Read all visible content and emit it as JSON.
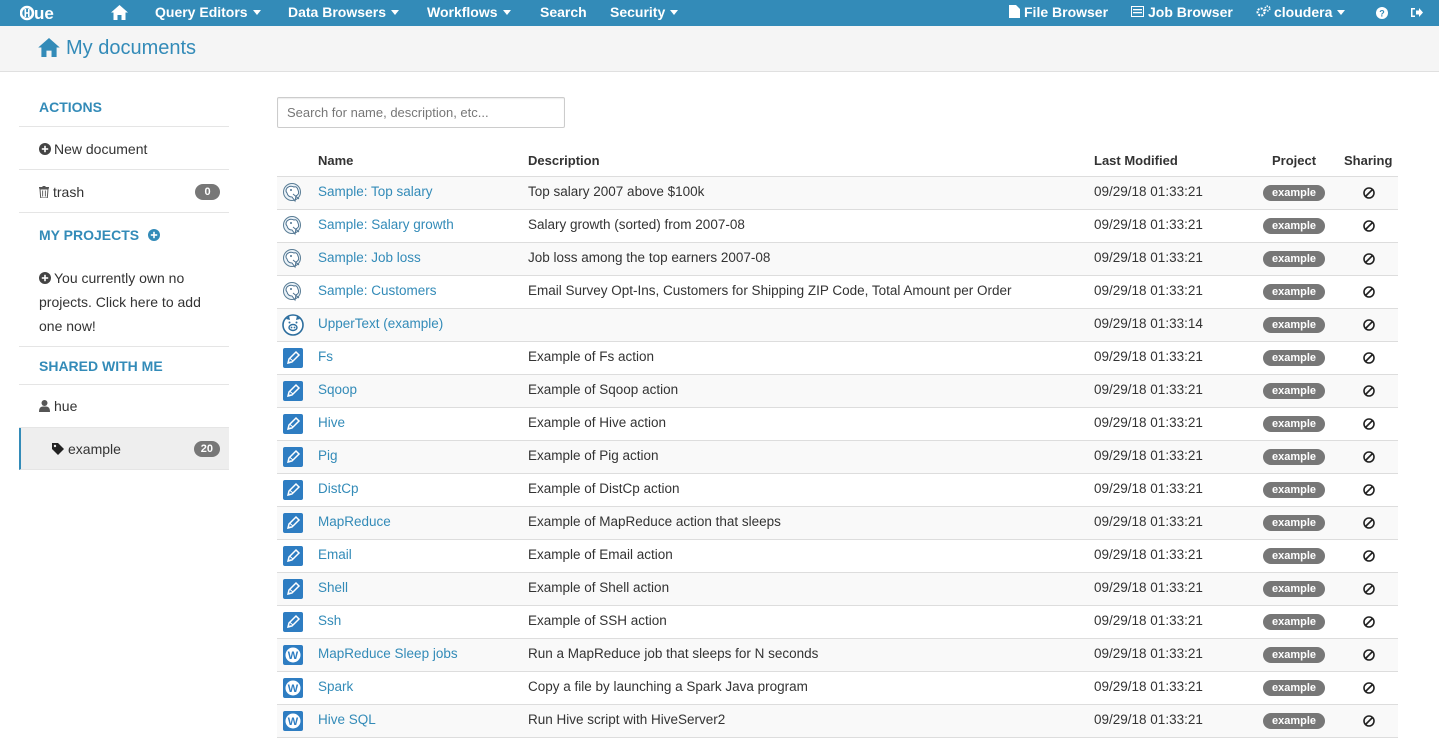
{
  "navbar": {
    "logo_text": "HUE",
    "items": [
      {
        "label": "Query Editors",
        "dropdown": true
      },
      {
        "label": "Data Browsers",
        "dropdown": true
      },
      {
        "label": "Workflows",
        "dropdown": true
      },
      {
        "label": "Search",
        "dropdown": false
      },
      {
        "label": "Security",
        "dropdown": true
      }
    ],
    "right": {
      "file_browser": "File Browser",
      "job_browser": "Job Browser",
      "user": "cloudera"
    },
    "icons": [
      "home-icon",
      "file-icon",
      "job-icon",
      "cogs-icon",
      "help-icon",
      "logout-icon"
    ],
    "bar_color": "#338bb8"
  },
  "page": {
    "title": "My documents"
  },
  "sidebar": {
    "actions_heading": "ACTIONS",
    "new_document": "New document",
    "trash_label": "trash",
    "trash_count": "0",
    "projects_heading": "MY PROJECTS",
    "no_projects_text": "You currently own no projects. Click here to add one now!",
    "shared_heading": "SHARED WITH ME",
    "shared_user": "hue",
    "shared_tag": "example",
    "shared_tag_count": "20"
  },
  "search": {
    "placeholder": "Search for name, description, etc..."
  },
  "table": {
    "columns": {
      "name": "Name",
      "description": "Description",
      "modified": "Last Modified",
      "project": "Project",
      "sharing": "Sharing"
    },
    "rows": [
      {
        "icon": "beeswax",
        "name": "Sample: Top salary",
        "description": "Top salary 2007 above $100k",
        "modified": "09/29/18 01:33:21",
        "project": "example"
      },
      {
        "icon": "beeswax",
        "name": "Sample: Salary growth",
        "description": "Salary growth (sorted) from 2007-08",
        "modified": "09/29/18 01:33:21",
        "project": "example"
      },
      {
        "icon": "beeswax",
        "name": "Sample: Job loss",
        "description": "Job loss among the top earners 2007-08",
        "modified": "09/29/18 01:33:21",
        "project": "example"
      },
      {
        "icon": "beeswax",
        "name": "Sample: Customers",
        "description": "Email Survey Opt-Ins, Customers for Shipping ZIP Code, Total Amount per Order",
        "modified": "09/29/18 01:33:21",
        "project": "example"
      },
      {
        "icon": "pig",
        "name": "UpperText (example)",
        "description": "",
        "modified": "09/29/18 01:33:14",
        "project": "example"
      },
      {
        "icon": "oozie-action",
        "name": "Fs",
        "description": "Example of Fs action",
        "modified": "09/29/18 01:33:21",
        "project": "example"
      },
      {
        "icon": "oozie-action",
        "name": "Sqoop",
        "description": "Example of Sqoop action",
        "modified": "09/29/18 01:33:21",
        "project": "example"
      },
      {
        "icon": "oozie-action",
        "name": "Hive",
        "description": "Example of Hive action",
        "modified": "09/29/18 01:33:21",
        "project": "example"
      },
      {
        "icon": "oozie-action",
        "name": "Pig",
        "description": "Example of Pig action",
        "modified": "09/29/18 01:33:21",
        "project": "example"
      },
      {
        "icon": "oozie-action",
        "name": "DistCp",
        "description": "Example of DistCp action",
        "modified": "09/29/18 01:33:21",
        "project": "example"
      },
      {
        "icon": "oozie-action",
        "name": "MapReduce",
        "description": "Example of MapReduce action that sleeps",
        "modified": "09/29/18 01:33:21",
        "project": "example"
      },
      {
        "icon": "oozie-action",
        "name": "Email",
        "description": "Example of Email action",
        "modified": "09/29/18 01:33:21",
        "project": "example"
      },
      {
        "icon": "oozie-action",
        "name": "Shell",
        "description": "Example of Shell action",
        "modified": "09/29/18 01:33:21",
        "project": "example"
      },
      {
        "icon": "oozie-action",
        "name": "Ssh",
        "description": "Example of SSH action",
        "modified": "09/29/18 01:33:21",
        "project": "example"
      },
      {
        "icon": "workflow",
        "name": "MapReduce Sleep jobs",
        "description": "Run a MapReduce job that sleeps for N seconds",
        "modified": "09/29/18 01:33:21",
        "project": "example"
      },
      {
        "icon": "workflow",
        "name": "Spark",
        "description": "Copy a file by launching a Spark Java program",
        "modified": "09/29/18 01:33:21",
        "project": "example"
      },
      {
        "icon": "workflow",
        "name": "Hive SQL",
        "description": "Run Hive script with HiveServer2",
        "modified": "09/29/18 01:33:21",
        "project": "example"
      }
    ]
  }
}
